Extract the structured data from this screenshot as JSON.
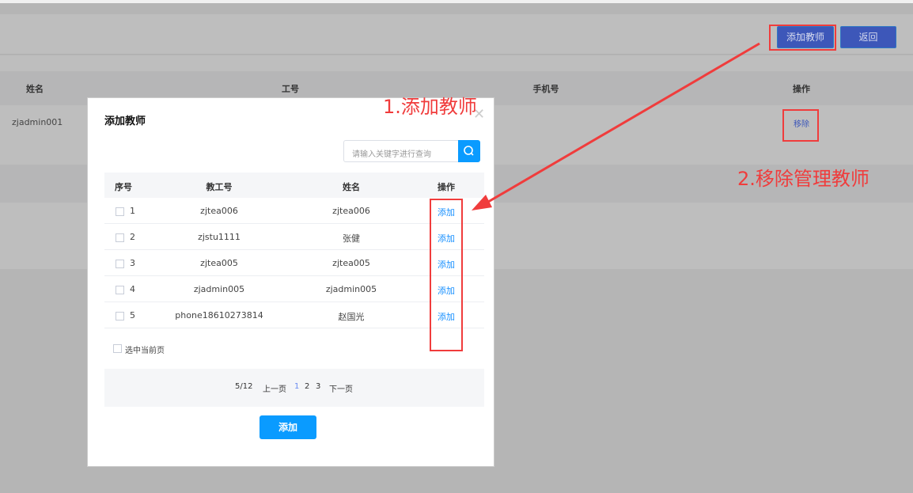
{
  "page": {
    "add_teacher_button": "添加教师",
    "back_button": "返回",
    "table": {
      "headers": [
        "姓名",
        "工号",
        "手机号",
        "操作"
      ],
      "rows": [
        {
          "name": "zjadmin001",
          "action": "移除"
        }
      ]
    }
  },
  "modal": {
    "title": "添加教师",
    "close_icon": "close-icon",
    "search": {
      "placeholder": "请输入关键字进行查询",
      "icon": "search-icon"
    },
    "headers": [
      "序号",
      "教工号",
      "姓名",
      "操作"
    ],
    "rows": [
      {
        "index": "1",
        "id": "zjtea006",
        "name": "zjtea006",
        "action": "添加"
      },
      {
        "index": "2",
        "id": "zjstu1111",
        "name": "张健",
        "action": "添加"
      },
      {
        "index": "3",
        "id": "zjtea005",
        "name": "zjtea005",
        "action": "添加"
      },
      {
        "index": "4",
        "id": "zjadmin005",
        "name": "zjadmin005",
        "action": "添加"
      },
      {
        "index": "5",
        "id": "phone18610273814",
        "name": "赵国光",
        "action": "添加"
      }
    ],
    "select_page_label": "选中当前页",
    "pagination": {
      "info": "5/12",
      "prev": "上一页",
      "pages": [
        "1",
        "2",
        "3"
      ],
      "current": "1",
      "next": "下一页"
    },
    "submit_button": "添加"
  },
  "annotations": {
    "step1": "1.添加教师",
    "step2": "2.移除管理教师",
    "color": "#f03c3c"
  }
}
